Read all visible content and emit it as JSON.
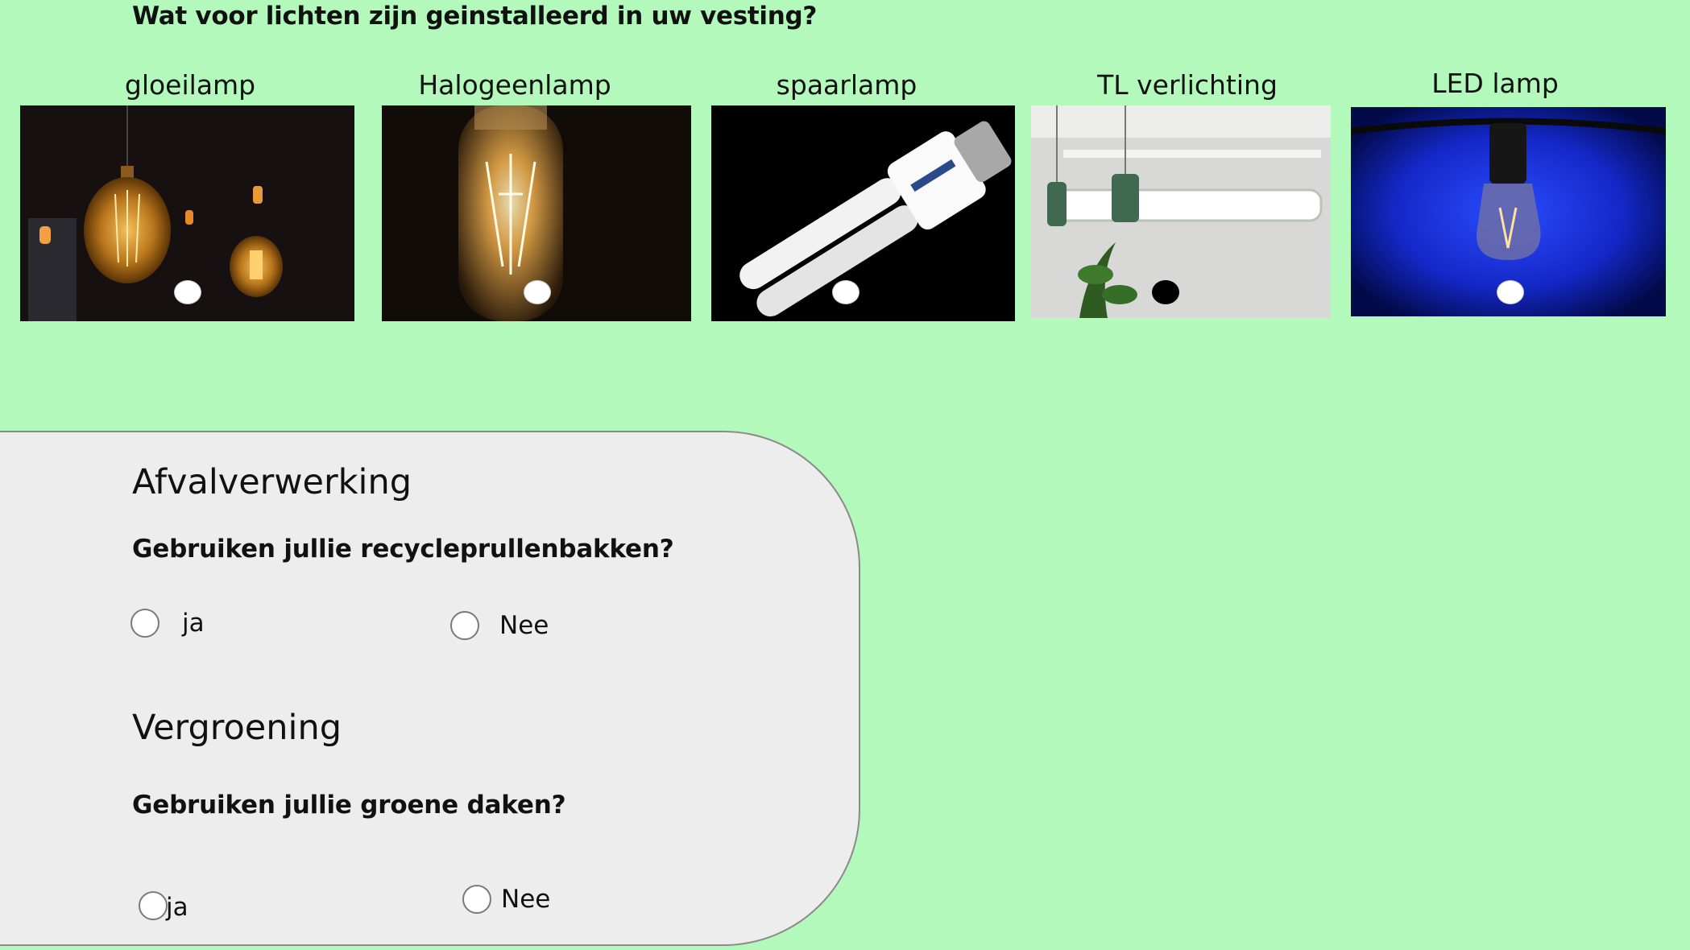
{
  "lights_question": "Wat voor lichten zijn geinstalleerd in uw vesting?",
  "lamps": [
    {
      "label": "gloeilamp",
      "image_icon": "incandescent-bulb-photo",
      "selected": false
    },
    {
      "label": "Halogeenlamp",
      "image_icon": "halogen-bulb-photo",
      "selected": false
    },
    {
      "label": "spaarlamp",
      "image_icon": "energy-saving-bulb-photo",
      "selected": false
    },
    {
      "label": "TL verlichting",
      "image_icon": "fluorescent-tube-photo",
      "selected": true
    },
    {
      "label": "LED lamp",
      "image_icon": "led-bulb-photo",
      "selected": false
    }
  ],
  "waste": {
    "heading": "Afvalverwerking",
    "question": "Gebruiken jullie recycleprullenbakken?",
    "options": [
      "ja",
      "Nee"
    ]
  },
  "green": {
    "heading": "Vergroening",
    "question": "Gebruiken jullie groene daken?",
    "options": [
      "ja",
      "Nee"
    ]
  },
  "colors": {
    "background": "#b2f9bb",
    "panel": "#ededed"
  }
}
